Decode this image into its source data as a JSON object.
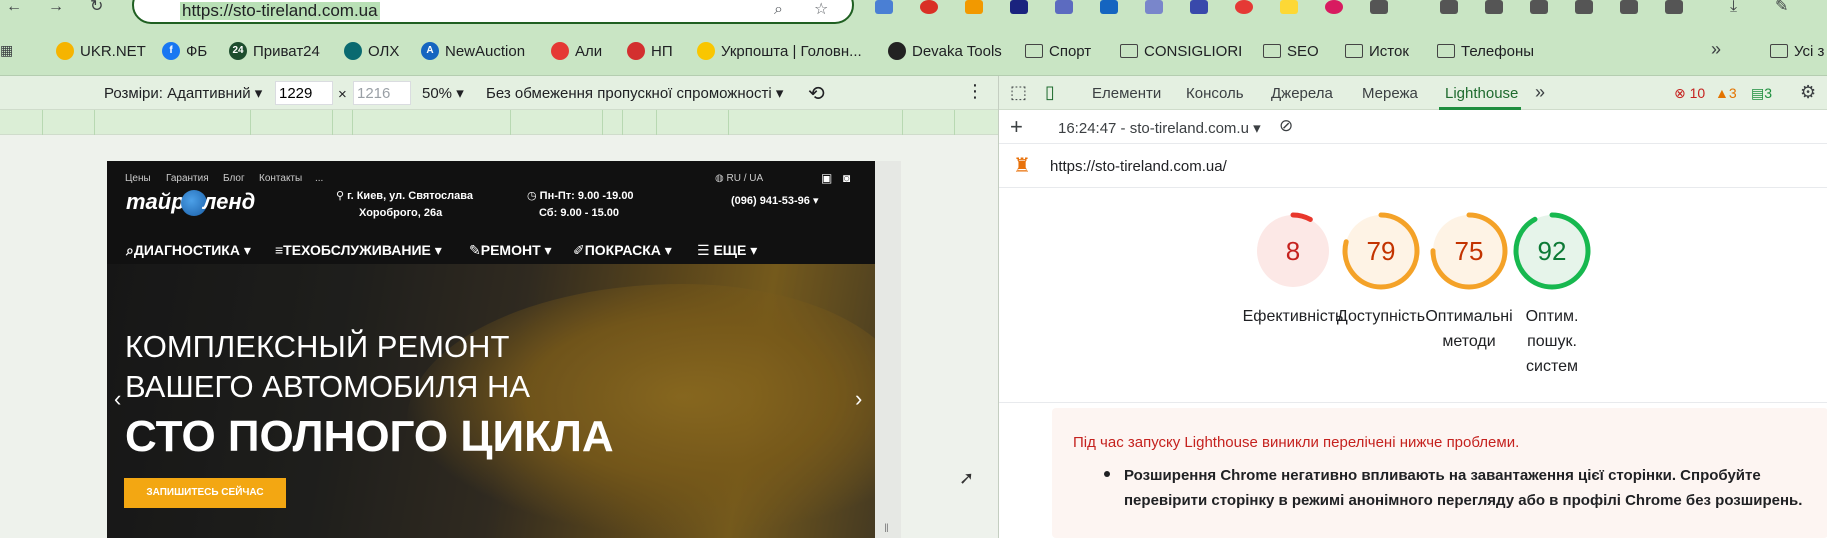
{
  "browser": {
    "url": "https://sto-tireland.com.ua"
  },
  "bookmarks": [
    {
      "label": "UKR.NET",
      "icon": "ukrnet-icon",
      "color": "#f6b400",
      "glyph": ""
    },
    {
      "label": "ФБ",
      "icon": "facebook-icon",
      "color": "#1877f2",
      "glyph": "f"
    },
    {
      "label": "Приват24",
      "icon": "privat24-icon",
      "color": "#1d4d2e",
      "glyph": "24"
    },
    {
      "label": "ОЛХ",
      "icon": "olx-icon",
      "color": "#0a6a70",
      "glyph": ""
    },
    {
      "label": "NewAuction",
      "icon": "newauction-icon",
      "color": "#1565c0",
      "glyph": "A"
    },
    {
      "label": "Али",
      "icon": "aliexpress-icon",
      "color": "#e53935",
      "glyph": ""
    },
    {
      "label": "НП",
      "icon": "novaposhta-icon",
      "color": "#d32f2f",
      "glyph": ""
    },
    {
      "label": "Укрпошта | Головн...",
      "icon": "ukrposhta-icon",
      "color": "#f9c600",
      "glyph": ""
    },
    {
      "label": "Devaka Tools",
      "icon": "devaka-icon",
      "color": "#222222",
      "glyph": ""
    },
    {
      "label": "Спорт",
      "icon": "folder-icon"
    },
    {
      "label": "CONSIGLIORI",
      "icon": "folder-icon"
    },
    {
      "label": "SEO",
      "icon": "folder-icon"
    },
    {
      "label": "Исток",
      "icon": "folder-icon"
    },
    {
      "label": "Телефоны",
      "icon": "folder-icon"
    },
    {
      "label": "Усі з",
      "icon": "folder-icon"
    }
  ],
  "device_toolbar": {
    "dimensions_label": "Розміри: Адаптивний",
    "width": "1229",
    "height": "1216",
    "times": "×",
    "zoom": "50%",
    "throttling": "Без обмеження пропускної спроможності"
  },
  "site": {
    "top_links": [
      "Цены",
      "Гарантия",
      "Блог",
      "Контакты",
      "..."
    ],
    "lang": "RU / UA",
    "logo_left": "тайр",
    "logo_right": "ленд",
    "address_line1": "г. Киев, ул. Святослава",
    "address_line2": "Хороброго, 26а",
    "hours_line1": "Пн-Пт: 9.00 -19.00",
    "hours_line2": "Сб: 9.00 - 15.00",
    "phone": "(096) 941-53-96",
    "menu": [
      "ДИАГНОСТИКА",
      "ТЕХОБСЛУЖИВАНИЕ",
      "РЕМОНТ",
      "ПОКРАСКА",
      "ЕЩЕ"
    ],
    "hero_line1": "КОМПЛЕКСНЫЙ РЕМОНТ",
    "hero_line2": "ВАШЕГО АВТОМОБИЛЯ НА",
    "hero_line3": "СТО ПОЛНОГО ЦИКЛА",
    "cta": "ЗАПИШИТЕСЬ СЕЙЧАС"
  },
  "devtools": {
    "tabs": [
      "Елементи",
      "Консоль",
      "Джерела",
      "Мережа",
      "Lighthouse"
    ],
    "errors": "10",
    "warnings": "3",
    "messages": "3",
    "report_time": "16:24:47 - sto-tireland.com.u",
    "report_url": "https://sto-tireland.com.ua/",
    "scores": [
      {
        "value": 8,
        "label_lines": [
          "Ефективність"
        ],
        "color": "#e8372c",
        "bg": "#fce8e6"
      },
      {
        "value": 79,
        "label_lines": [
          "Доступність"
        ],
        "color": "#f4a228",
        "bg": "#fef3e5"
      },
      {
        "value": 75,
        "label_lines": [
          "Оптимальні",
          "методи"
        ],
        "color": "#f4a228",
        "bg": "#fef3e5"
      },
      {
        "value": 92,
        "label_lines": [
          "Оптим.",
          "пошук.",
          "систем"
        ],
        "color": "#17b84f",
        "bg": "#e6f4ea"
      }
    ],
    "warning_title": "Під час запуску Lighthouse виникли перелічені нижче проблеми.",
    "warning_item": "Розширення Chrome негативно впливають на завантаження цієї сторінки. Спробуйте перевірити сторінку в режимі анонімного перегляду або в профілі Chrome без розширень."
  }
}
